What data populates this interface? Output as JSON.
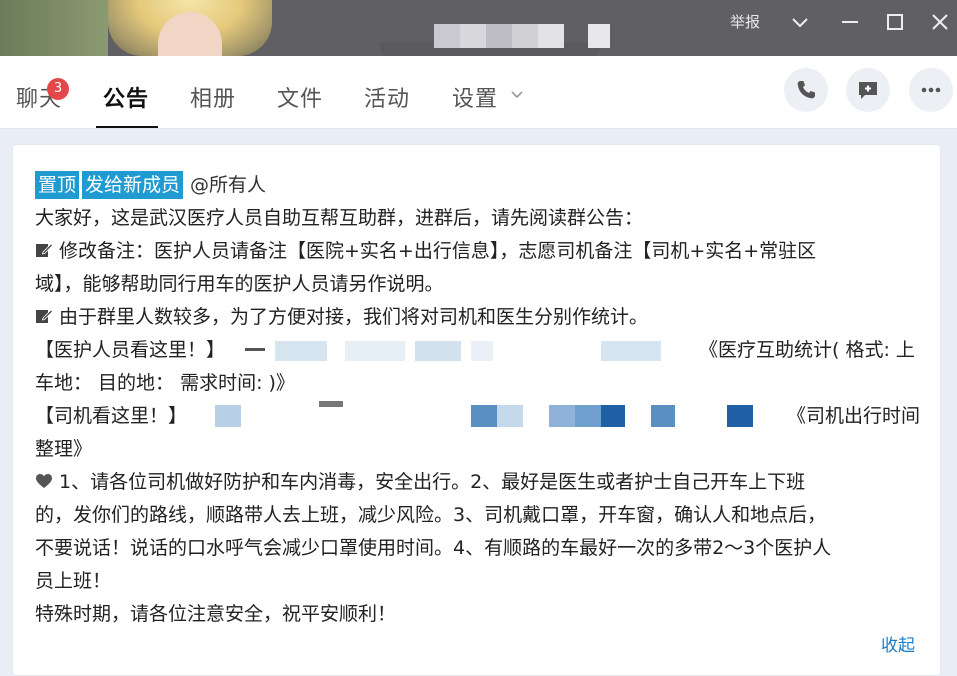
{
  "window": {
    "report_label": "举报"
  },
  "tabs": [
    {
      "label": "聊天",
      "badge": "3"
    },
    {
      "label": "公告"
    },
    {
      "label": "相册"
    },
    {
      "label": "文件"
    },
    {
      "label": "活动"
    },
    {
      "label": "设置"
    }
  ],
  "active_tab": "公告",
  "announcement": {
    "tags": [
      "置顶",
      "发给新成员"
    ],
    "mention": "@所有人",
    "lines": [
      "大家好，这是武汉医疗人员自助互帮互助群，进群后，请先阅读群公告：",
      "修改备注：医护人员请备注【医院+实名+出行信息】，志愿司机备注【司机+实名+常驻区",
      "域】，能够帮助同行用车的医护人员请另作说明。",
      "由于群里人数较多，为了方便对接，我们将对司机和医生分别作统计。",
      "【医护人员看这里！】",
      "《医疗互助统计( 格式: 上",
      "车地： 目的地： 需求时间: )》",
      "【司机看这里！】",
      "《司机出行时间",
      "整理》",
      "1、请各位司机做好防护和车内消毒，安全出行。2、最好是医生或者护士自己开车上下班",
      "的，发你们的路线，顺路带人去上班，减少风险。3、司机戴口罩，开车窗，确认人和地点后，",
      "不要说话！说话的口水呼气会减少口罩使用时间。4、有顺路的车最好一次的多带2～3个医护人",
      "员上班！",
      "特殊时期，请各位注意安全，祝平安顺利！"
    ],
    "collapse_label": "收起"
  },
  "icons": {
    "minimize": "minimize-icon",
    "maximize": "maximize-icon",
    "close": "close-icon",
    "dropdown": "chevron-down-icon",
    "phone": "phone-icon",
    "message": "message-add-icon",
    "more": "more-icon",
    "note": "edit-note-icon",
    "heart": "heart-icon"
  },
  "colors": {
    "tag_bg": "#1f9bd1",
    "badge": "#e4474a",
    "link": "#1a7cc9",
    "titlebar": "#5f5f64"
  }
}
